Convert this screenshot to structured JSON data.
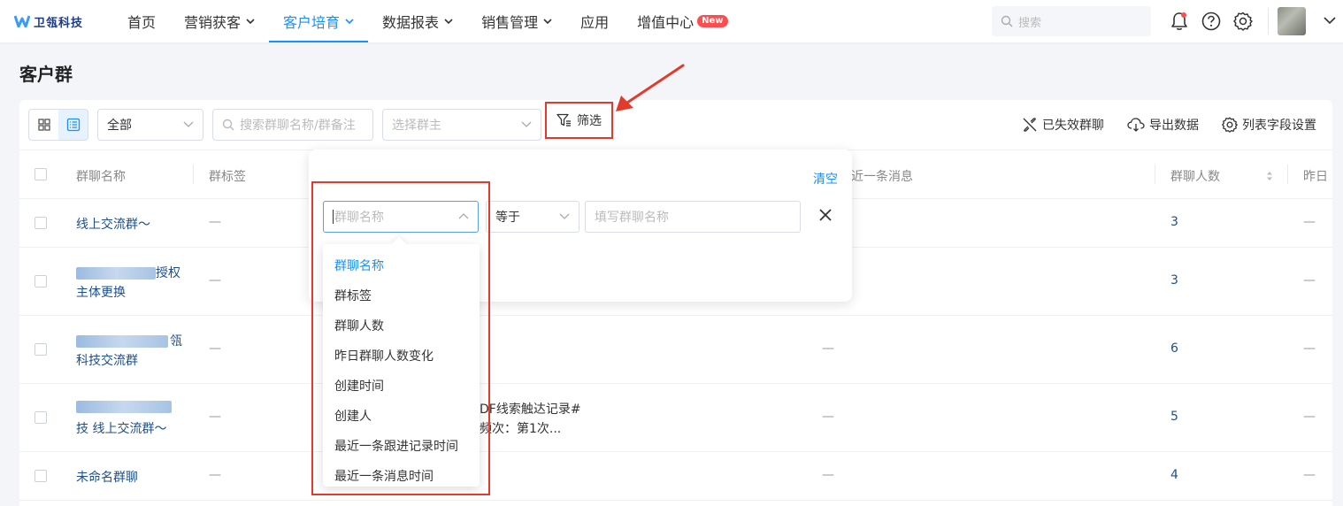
{
  "brand": {
    "name": "卫瓴科技"
  },
  "nav": {
    "items": [
      {
        "label": "首页",
        "has_chevron": false,
        "active": false
      },
      {
        "label": "营销获客",
        "has_chevron": true,
        "active": false
      },
      {
        "label": "客户培育",
        "has_chevron": true,
        "active": true
      },
      {
        "label": "数据报表",
        "has_chevron": true,
        "active": false
      },
      {
        "label": "销售管理",
        "has_chevron": true,
        "active": false
      },
      {
        "label": "应用",
        "has_chevron": false,
        "active": false
      },
      {
        "label": "增值中心",
        "has_chevron": false,
        "active": false,
        "badge": "New"
      }
    ],
    "search_placeholder": "搜索",
    "icons": [
      "bell-icon",
      "help-icon",
      "gear-icon"
    ]
  },
  "page": {
    "title": "客户群"
  },
  "toolbar": {
    "scope_select": "全部",
    "search_placeholder": "搜索群聊名称/群备注",
    "owner_placeholder": "选择群主",
    "filter_label": "筛选",
    "invalid_groups": "已失效群聊",
    "export": "导出数据",
    "column_settings": "列表字段设置"
  },
  "table": {
    "headers": {
      "name": "群聊名称",
      "tag": "群标签",
      "last_message": "最近一条消息",
      "member_count": "群聊人数",
      "yesterday": "昨日"
    },
    "rows": [
      {
        "name_line1": "线上交流群～",
        "name_line2": "",
        "tag": "—",
        "message_line1": "",
        "message_line2": "",
        "col_mid": "",
        "count": "3",
        "yesterday": "—"
      },
      {
        "name_line1": "授权",
        "name_line2": "主体更换",
        "tag": "—",
        "message_line1": "",
        "message_line2": "",
        "col_mid": "",
        "count": "3",
        "yesterday": "—"
      },
      {
        "name_line1": "瓴",
        "name_line2": "科技交流群",
        "tag": "—",
        "message_line1": "",
        "message_line2": "",
        "col_mid": "—",
        "count": "6",
        "yesterday": "—"
      },
      {
        "name_line1": "",
        "name_line2": "技 线上交流群～",
        "tag": "—",
        "message_line1": "DF线索触达记录#",
        "message_line2": "频次：第1次...",
        "col_mid": "—",
        "count": "5",
        "yesterday": "—"
      },
      {
        "name_line1": "未命名群聊",
        "name_line2": "",
        "tag": "—",
        "message_line1": "",
        "message_line2": "",
        "col_mid": "—",
        "count": "4",
        "yesterday": "—"
      }
    ]
  },
  "filter_popover": {
    "clear_label": "清空",
    "field_placeholder": "群聊名称",
    "operator": "等于",
    "value_placeholder": "填写群聊名称"
  },
  "field_dropdown": {
    "options": [
      "群聊名称",
      "群标签",
      "群聊人数",
      "昨日群聊人数变化",
      "创建时间",
      "创建人",
      "最近一条跟进记录时间",
      "最近一条消息时间"
    ],
    "selected_index": 0
  },
  "colors": {
    "accent": "#1890ff",
    "link": "#1d4f8c",
    "annotation_red": "#e23b2d",
    "badge_red": "#ff4d4f"
  }
}
